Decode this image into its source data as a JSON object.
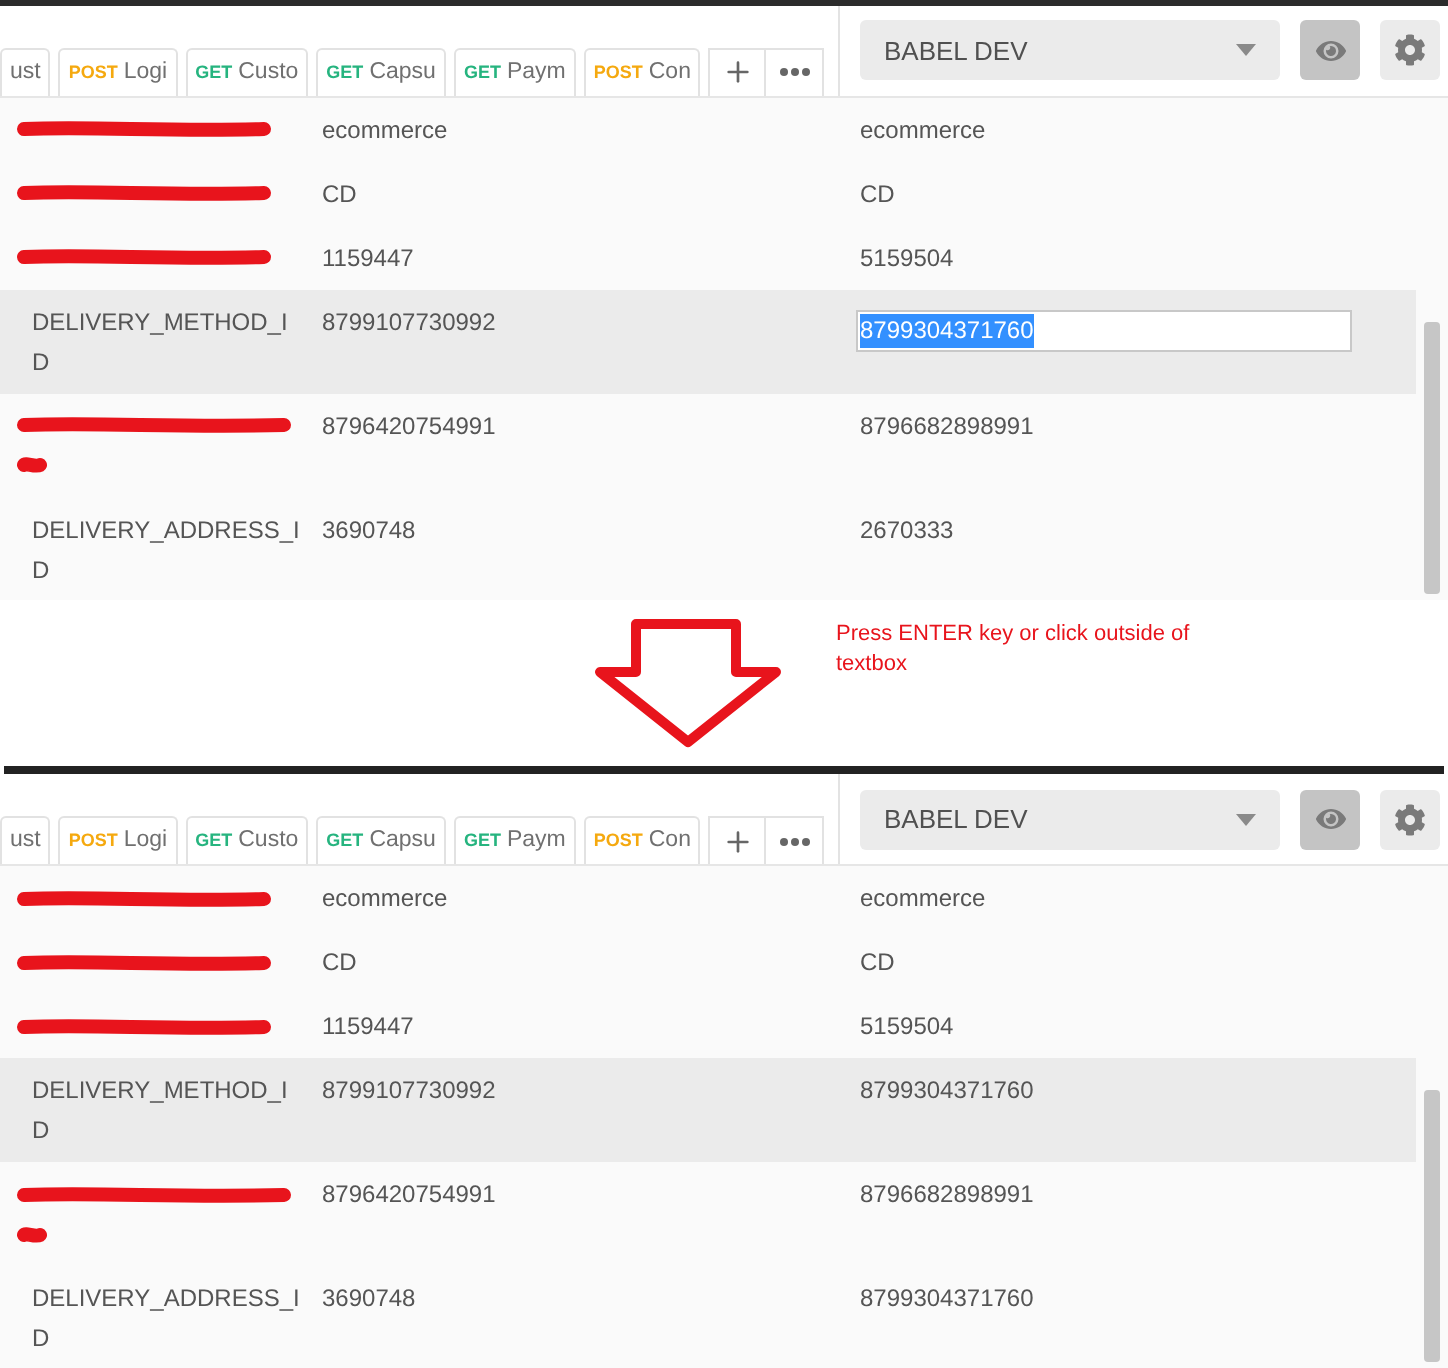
{
  "panels": [
    {
      "tabs": [
        {
          "label": "ust"
        },
        {
          "method": "POST",
          "color": "#f5a90f",
          "label": "Logi"
        },
        {
          "method": "GET",
          "color": "#26b47f",
          "label": "Custo"
        },
        {
          "method": "GET",
          "color": "#26b47f",
          "label": "Capsu"
        },
        {
          "method": "GET",
          "color": "#26b47f",
          "label": "Paym"
        },
        {
          "method": "POST",
          "color": "#f5a90f",
          "label": "Con"
        }
      ],
      "environment": {
        "name": "BABEL DEV"
      },
      "quick_look": {
        "selected": true
      },
      "rows": [
        {
          "kind": "redacted",
          "values": [
            "ecommerce",
            "ecommerce"
          ],
          "highlighted": false,
          "editing": false
        },
        {
          "kind": "redacted",
          "values": [
            "CD",
            "CD"
          ],
          "highlighted": false,
          "editing": false
        },
        {
          "kind": "redacted",
          "values": [
            "1159447",
            "5159504"
          ],
          "highlighted": false,
          "editing": false
        },
        {
          "kind": "plain",
          "key": "DELIVERY_METHOD_ID",
          "values": [
            "8799107730992",
            "8799304371760"
          ],
          "highlighted": true,
          "editing": true
        },
        {
          "kind": "redacted_wrapped",
          "values": [
            "8796420754991",
            "8796682898991"
          ],
          "highlighted": false,
          "editing": false
        },
        {
          "kind": "plain",
          "key": "DELIVERY_ADDRESS_ID",
          "values": [
            "3690748",
            "2670333"
          ],
          "highlighted": false,
          "editing": false
        }
      ]
    },
    {
      "tabs": [
        {
          "label": "ust"
        },
        {
          "method": "POST",
          "color": "#f5a90f",
          "label": "Logi"
        },
        {
          "method": "GET",
          "color": "#26b47f",
          "label": "Custo"
        },
        {
          "method": "GET",
          "color": "#26b47f",
          "label": "Capsu"
        },
        {
          "method": "GET",
          "color": "#26b47f",
          "label": "Paym"
        },
        {
          "method": "POST",
          "color": "#f5a90f",
          "label": "Con"
        }
      ],
      "environment": {
        "name": "BABEL DEV"
      },
      "quick_look": {
        "selected": true
      },
      "rows": [
        {
          "kind": "redacted",
          "values": [
            "ecommerce",
            "ecommerce"
          ],
          "highlighted": false,
          "editing": false
        },
        {
          "kind": "redacted",
          "values": [
            "CD",
            "CD"
          ],
          "highlighted": false,
          "editing": false
        },
        {
          "kind": "redacted",
          "values": [
            "1159447",
            "5159504"
          ],
          "highlighted": false,
          "editing": false
        },
        {
          "kind": "plain",
          "key": "DELIVERY_METHOD_ID",
          "values": [
            "8799107730992",
            "8799304371760"
          ],
          "highlighted": true,
          "editing": false
        },
        {
          "kind": "redacted_wrapped",
          "values": [
            "8796420754991",
            "8796682898991"
          ],
          "highlighted": false,
          "editing": false
        },
        {
          "kind": "plain",
          "key": "DELIVERY_ADDRESS_ID",
          "values": [
            "3690748",
            "8799304371760"
          ],
          "highlighted": false,
          "editing": false
        }
      ]
    }
  ],
  "annotation": {
    "text": "Press ENTER key or click outside of textbox"
  }
}
